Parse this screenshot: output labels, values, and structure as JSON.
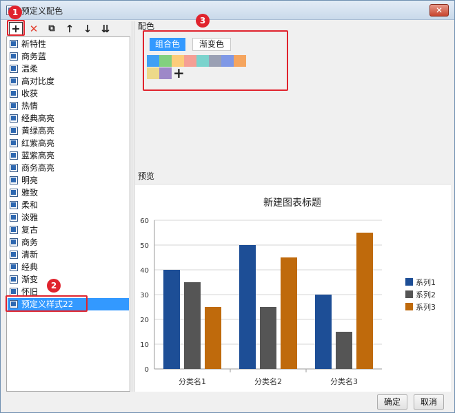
{
  "window": {
    "title": "预定义配色",
    "close_label": "✕"
  },
  "toolbar": {
    "add": "+",
    "delete": "✕",
    "copy": "⧉",
    "up": "↑",
    "down": "↓",
    "sort": "⇊"
  },
  "styles_list": {
    "items": [
      "新特性",
      "商务蓝",
      "温柔",
      "高对比度",
      "收获",
      "热情",
      "经典高亮",
      "黄绿高亮",
      "红紫高亮",
      "蓝紫高亮",
      "商务高亮",
      "明亮",
      "雅致",
      "柔和",
      "淡雅",
      "复古",
      "商务",
      "清新",
      "经典",
      "渐变",
      "怀旧",
      "预定义样式22"
    ],
    "selected_index": 21
  },
  "palette": {
    "section_label": "配色",
    "tabs": [
      {
        "label": "组合色",
        "active": true
      },
      {
        "label": "渐变色",
        "active": false
      }
    ],
    "colors": [
      "#3fa0f5",
      "#82d07f",
      "#fccc7a",
      "#f59f95",
      "#7bd3cd",
      "#9aa0b4",
      "#7f98e6",
      "#f5a55f",
      "#edd989",
      "#9d88c8"
    ],
    "add_label": "+"
  },
  "preview": {
    "section_label": "预览"
  },
  "chart_data": {
    "type": "bar",
    "title": "新建图表标题",
    "categories": [
      "分类名1",
      "分类名2",
      "分类名3"
    ],
    "series": [
      {
        "name": "系列1",
        "color": "#1d4e96",
        "values": [
          40,
          50,
          30
        ]
      },
      {
        "name": "系列2",
        "color": "#555555",
        "values": [
          35,
          25,
          15
        ]
      },
      {
        "name": "系列3",
        "color": "#bf6a0c",
        "values": [
          25,
          45,
          55
        ]
      }
    ],
    "ylim": [
      0,
      60
    ],
    "yticks": [
      0,
      10,
      20,
      30,
      40,
      50,
      60
    ],
    "grid": true,
    "legend": "right"
  },
  "footer": {
    "ok_label": "确定",
    "cancel_label": "取消"
  },
  "annotations": {
    "badge1": "1",
    "badge2": "2",
    "badge3": "3",
    "color": "#e0232d"
  }
}
